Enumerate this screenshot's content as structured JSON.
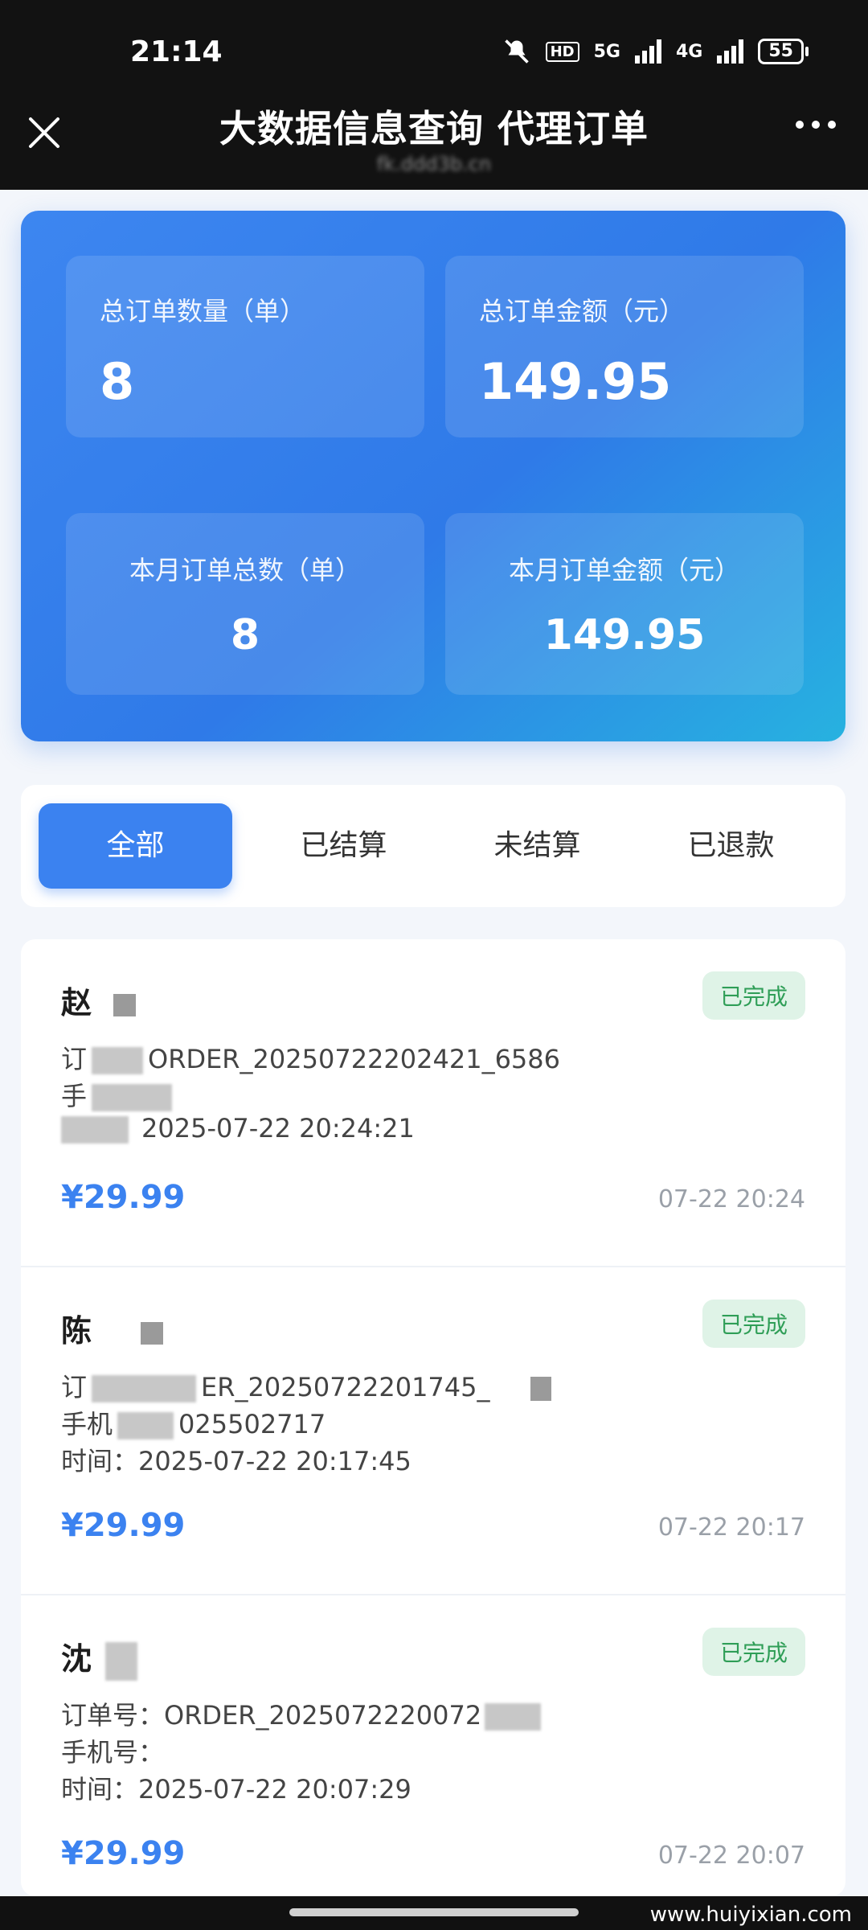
{
  "status_bar": {
    "time": "21:14",
    "network1": "5G",
    "network2": "4G",
    "hd": "HD",
    "battery": "55"
  },
  "header": {
    "title": "大数据信息查询 代理订单",
    "subtitle": "fk.ddd3b.cn"
  },
  "stats": {
    "total_orders_label": "总订单数量（单）",
    "total_orders_value": "8",
    "total_amount_label": "总订单金额（元）",
    "total_amount_value": "149.95",
    "month_orders_label": "本月订单总数（单）",
    "month_orders_value": "8",
    "month_amount_label": "本月订单金额（元）",
    "month_amount_value": "149.95"
  },
  "tabs": [
    "全部",
    "已结算",
    "未结算",
    "已退款"
  ],
  "orders": [
    {
      "name": "赵",
      "status": "已完成",
      "order_line": "ORDER_20250722202421_6586",
      "phone_line": "",
      "time_line": "2025-07-22 20:24:21",
      "price": "¥29.99",
      "stamp": "07-22 20:24"
    },
    {
      "name": "陈",
      "status": "已完成",
      "order_line": "ER_20250722201745_",
      "phone_line": "025502717",
      "time_line": "时间：2025-07-22 20:17:45",
      "price": "¥29.99",
      "stamp": "07-22 20:17"
    },
    {
      "name": "沈",
      "status": "已完成",
      "order_line": "订单号：ORDER_2025072220072",
      "phone_line": "手机号：",
      "time_line": "时间：2025-07-22 20:07:29",
      "price": "¥29.99",
      "stamp": "07-22 20:07"
    }
  ],
  "watermark": "www.huiyixian.com"
}
